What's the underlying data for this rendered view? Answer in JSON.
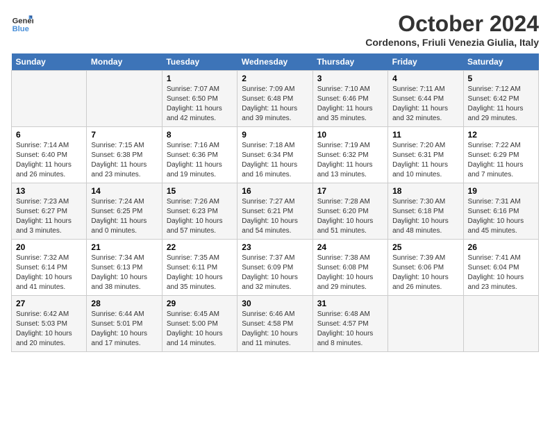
{
  "header": {
    "logo_line1": "General",
    "logo_line2": "Blue",
    "month": "October 2024",
    "location": "Cordenons, Friuli Venezia Giulia, Italy"
  },
  "days_of_week": [
    "Sunday",
    "Monday",
    "Tuesday",
    "Wednesday",
    "Thursday",
    "Friday",
    "Saturday"
  ],
  "weeks": [
    [
      {
        "day": null
      },
      {
        "day": null
      },
      {
        "day": "1",
        "sunrise": "Sunrise: 7:07 AM",
        "sunset": "Sunset: 6:50 PM",
        "daylight": "Daylight: 11 hours and 42 minutes."
      },
      {
        "day": "2",
        "sunrise": "Sunrise: 7:09 AM",
        "sunset": "Sunset: 6:48 PM",
        "daylight": "Daylight: 11 hours and 39 minutes."
      },
      {
        "day": "3",
        "sunrise": "Sunrise: 7:10 AM",
        "sunset": "Sunset: 6:46 PM",
        "daylight": "Daylight: 11 hours and 35 minutes."
      },
      {
        "day": "4",
        "sunrise": "Sunrise: 7:11 AM",
        "sunset": "Sunset: 6:44 PM",
        "daylight": "Daylight: 11 hours and 32 minutes."
      },
      {
        "day": "5",
        "sunrise": "Sunrise: 7:12 AM",
        "sunset": "Sunset: 6:42 PM",
        "daylight": "Daylight: 11 hours and 29 minutes."
      }
    ],
    [
      {
        "day": "6",
        "sunrise": "Sunrise: 7:14 AM",
        "sunset": "Sunset: 6:40 PM",
        "daylight": "Daylight: 11 hours and 26 minutes."
      },
      {
        "day": "7",
        "sunrise": "Sunrise: 7:15 AM",
        "sunset": "Sunset: 6:38 PM",
        "daylight": "Daylight: 11 hours and 23 minutes."
      },
      {
        "day": "8",
        "sunrise": "Sunrise: 7:16 AM",
        "sunset": "Sunset: 6:36 PM",
        "daylight": "Daylight: 11 hours and 19 minutes."
      },
      {
        "day": "9",
        "sunrise": "Sunrise: 7:18 AM",
        "sunset": "Sunset: 6:34 PM",
        "daylight": "Daylight: 11 hours and 16 minutes."
      },
      {
        "day": "10",
        "sunrise": "Sunrise: 7:19 AM",
        "sunset": "Sunset: 6:32 PM",
        "daylight": "Daylight: 11 hours and 13 minutes."
      },
      {
        "day": "11",
        "sunrise": "Sunrise: 7:20 AM",
        "sunset": "Sunset: 6:31 PM",
        "daylight": "Daylight: 11 hours and 10 minutes."
      },
      {
        "day": "12",
        "sunrise": "Sunrise: 7:22 AM",
        "sunset": "Sunset: 6:29 PM",
        "daylight": "Daylight: 11 hours and 7 minutes."
      }
    ],
    [
      {
        "day": "13",
        "sunrise": "Sunrise: 7:23 AM",
        "sunset": "Sunset: 6:27 PM",
        "daylight": "Daylight: 11 hours and 3 minutes."
      },
      {
        "day": "14",
        "sunrise": "Sunrise: 7:24 AM",
        "sunset": "Sunset: 6:25 PM",
        "daylight": "Daylight: 11 hours and 0 minutes."
      },
      {
        "day": "15",
        "sunrise": "Sunrise: 7:26 AM",
        "sunset": "Sunset: 6:23 PM",
        "daylight": "Daylight: 10 hours and 57 minutes."
      },
      {
        "day": "16",
        "sunrise": "Sunrise: 7:27 AM",
        "sunset": "Sunset: 6:21 PM",
        "daylight": "Daylight: 10 hours and 54 minutes."
      },
      {
        "day": "17",
        "sunrise": "Sunrise: 7:28 AM",
        "sunset": "Sunset: 6:20 PM",
        "daylight": "Daylight: 10 hours and 51 minutes."
      },
      {
        "day": "18",
        "sunrise": "Sunrise: 7:30 AM",
        "sunset": "Sunset: 6:18 PM",
        "daylight": "Daylight: 10 hours and 48 minutes."
      },
      {
        "day": "19",
        "sunrise": "Sunrise: 7:31 AM",
        "sunset": "Sunset: 6:16 PM",
        "daylight": "Daylight: 10 hours and 45 minutes."
      }
    ],
    [
      {
        "day": "20",
        "sunrise": "Sunrise: 7:32 AM",
        "sunset": "Sunset: 6:14 PM",
        "daylight": "Daylight: 10 hours and 41 minutes."
      },
      {
        "day": "21",
        "sunrise": "Sunrise: 7:34 AM",
        "sunset": "Sunset: 6:13 PM",
        "daylight": "Daylight: 10 hours and 38 minutes."
      },
      {
        "day": "22",
        "sunrise": "Sunrise: 7:35 AM",
        "sunset": "Sunset: 6:11 PM",
        "daylight": "Daylight: 10 hours and 35 minutes."
      },
      {
        "day": "23",
        "sunrise": "Sunrise: 7:37 AM",
        "sunset": "Sunset: 6:09 PM",
        "daylight": "Daylight: 10 hours and 32 minutes."
      },
      {
        "day": "24",
        "sunrise": "Sunrise: 7:38 AM",
        "sunset": "Sunset: 6:08 PM",
        "daylight": "Daylight: 10 hours and 29 minutes."
      },
      {
        "day": "25",
        "sunrise": "Sunrise: 7:39 AM",
        "sunset": "Sunset: 6:06 PM",
        "daylight": "Daylight: 10 hours and 26 minutes."
      },
      {
        "day": "26",
        "sunrise": "Sunrise: 7:41 AM",
        "sunset": "Sunset: 6:04 PM",
        "daylight": "Daylight: 10 hours and 23 minutes."
      }
    ],
    [
      {
        "day": "27",
        "sunrise": "Sunrise: 6:42 AM",
        "sunset": "Sunset: 5:03 PM",
        "daylight": "Daylight: 10 hours and 20 minutes."
      },
      {
        "day": "28",
        "sunrise": "Sunrise: 6:44 AM",
        "sunset": "Sunset: 5:01 PM",
        "daylight": "Daylight: 10 hours and 17 minutes."
      },
      {
        "day": "29",
        "sunrise": "Sunrise: 6:45 AM",
        "sunset": "Sunset: 5:00 PM",
        "daylight": "Daylight: 10 hours and 14 minutes."
      },
      {
        "day": "30",
        "sunrise": "Sunrise: 6:46 AM",
        "sunset": "Sunset: 4:58 PM",
        "daylight": "Daylight: 10 hours and 11 minutes."
      },
      {
        "day": "31",
        "sunrise": "Sunrise: 6:48 AM",
        "sunset": "Sunset: 4:57 PM",
        "daylight": "Daylight: 10 hours and 8 minutes."
      },
      {
        "day": null
      },
      {
        "day": null
      }
    ]
  ]
}
